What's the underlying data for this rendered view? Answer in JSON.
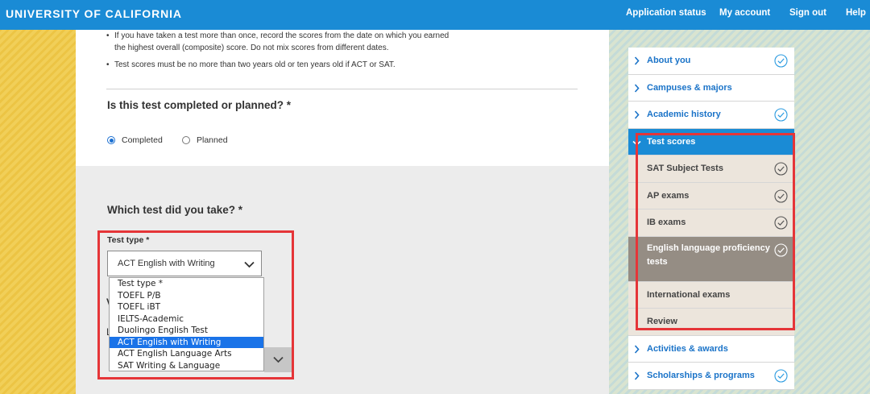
{
  "header": {
    "brand": "UNIVERSITY OF CALIFORNIA",
    "nav": [
      "Application status",
      "My account",
      "Sign out",
      "Help"
    ]
  },
  "instructions": [
    "If you have taken a test more than once, record the scores from the date on which you earned",
    "the highest overall (composite) score. Do not mix scores from different dates.",
    "Test scores must be no more than two years old or ten years old if ACT or SAT."
  ],
  "question_status": {
    "label": "Is this test completed or planned? *",
    "options": [
      "Completed",
      "Planned"
    ],
    "selected": "Completed"
  },
  "question_test": {
    "label": "Which test did you take? *",
    "field_label": "Test type *",
    "current_value": "ACT English with Writing",
    "options": [
      "Test type *",
      "TOEFL P/B",
      "TOEFL iBT",
      "IELTS-Academic",
      "Duolingo English Test",
      "ACT English with Writing",
      "ACT English Language Arts",
      "SAT Writing & Language"
    ],
    "highlighted_option": "ACT English with Writing"
  },
  "behind": {
    "v": "V",
    "l": "L"
  },
  "sidebar": {
    "items": [
      {
        "label": "About you",
        "type": "top",
        "checked": true
      },
      {
        "label": "Campuses & majors",
        "type": "top",
        "checked": false
      },
      {
        "label": "Academic history",
        "type": "top",
        "checked": true
      },
      {
        "label": "Test scores",
        "type": "active",
        "checked": false
      },
      {
        "label": "SAT Subject Tests",
        "type": "sub",
        "checked": true
      },
      {
        "label": "AP exams",
        "type": "sub",
        "checked": true
      },
      {
        "label": "IB exams",
        "type": "sub",
        "checked": true
      },
      {
        "label": "English language proficiency tests",
        "type": "subactive",
        "checked": true
      },
      {
        "label": "International exams",
        "type": "sub",
        "checked": false
      },
      {
        "label": "Review",
        "type": "sub",
        "checked": false
      },
      {
        "label": "Activities & awards",
        "type": "top",
        "checked": false
      },
      {
        "label": "Scholarships & programs",
        "type": "top",
        "checked": true
      }
    ]
  },
  "colors": {
    "header_blue": "#1a8bd5",
    "link_blue": "#1a73c8",
    "highlight_red": "#e53538",
    "check_green": "#2b9be0"
  },
  "icons": [
    "chevron-right-icon",
    "chevron-down-icon",
    "check-circle-icon"
  ]
}
